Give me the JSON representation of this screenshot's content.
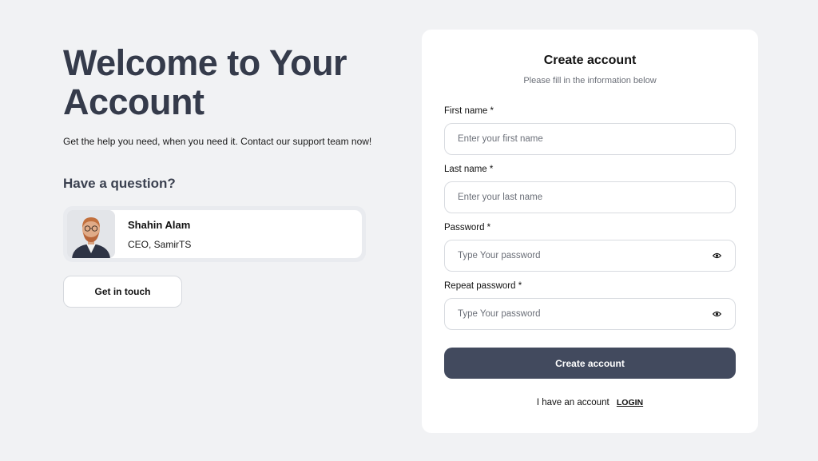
{
  "hero": {
    "title": "Welcome to Your Account",
    "subtitle": "Get the help you need, when you need it. Contact our support team now!"
  },
  "question": {
    "heading": "Have a question?"
  },
  "contact": {
    "name": "Shahin Alam",
    "role": "CEO, SamirTS",
    "button_label": "Get in touch"
  },
  "form": {
    "title": "Create account",
    "subtitle": "Please fill in the information below",
    "fields": [
      {
        "label": "First name *",
        "placeholder": "Enter your first name",
        "value": ""
      },
      {
        "label": "Last name *",
        "placeholder": "Enter your last name",
        "value": ""
      },
      {
        "label": "Password *",
        "placeholder": "Type Your password",
        "value": "",
        "icon": "eye-icon"
      },
      {
        "label": "Repeat password *",
        "placeholder": "Type Your password",
        "value": "",
        "icon": "eye-icon"
      }
    ],
    "submit_label": "Create account",
    "login_prompt": "I have an account",
    "login_link": "LOGIN"
  },
  "colors": {
    "background": "#f1f2f4",
    "heading": "#353b4b",
    "primary_button": "#424a5e",
    "card": "#ffffff"
  }
}
